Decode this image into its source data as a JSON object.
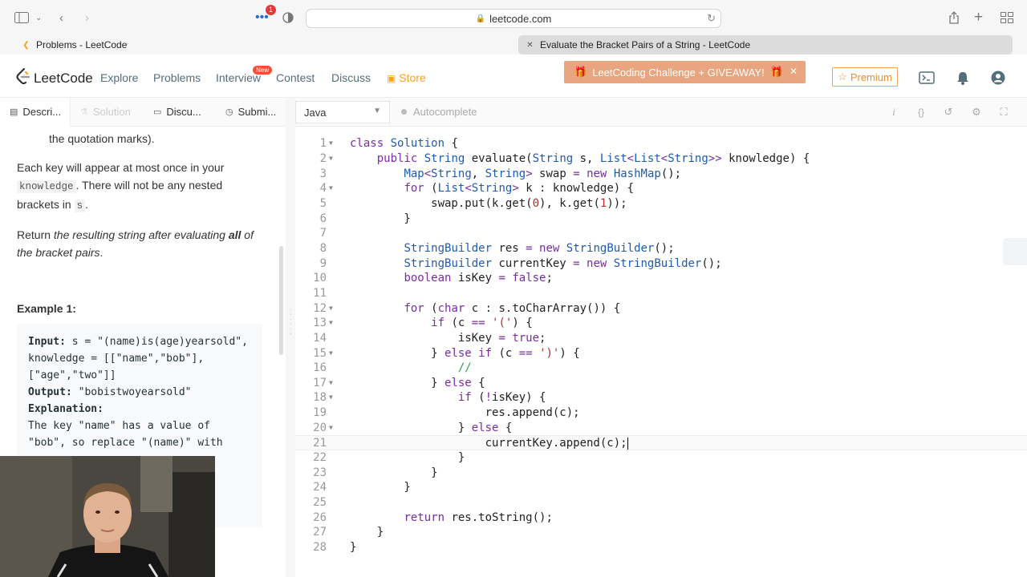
{
  "browser": {
    "url": "leetcode.com",
    "badge_count": "1"
  },
  "tabs": [
    {
      "title": "Problems - LeetCode"
    },
    {
      "title": "Evaluate the Bracket Pairs of a String - LeetCode"
    }
  ],
  "nav": {
    "brand": "LeetCode",
    "links": [
      "Explore",
      "Problems",
      "Interview",
      "Contest",
      "Discuss",
      "Store"
    ],
    "new_badge": "New",
    "promo": "LeetCoding Challenge + GIVEAWAY!",
    "premium": "Premium"
  },
  "left_tabs": [
    "Descri...",
    "Solution",
    "Discu...",
    "Submi..."
  ],
  "description": {
    "frag1": "the quotation marks).",
    "p1_a": "Each key will appear at most once in your ",
    "p1_code": "knowledge",
    "p1_b": ". There will not be any nested brackets in ",
    "p1_code2": "s",
    "p1_c": ".",
    "p2_a": "Return ",
    "p2_em": "the resulting string after evaluating ",
    "p2_strong": "all",
    "p2_em2": " of the bracket pairs",
    "p2_c": ".",
    "example_title": "Example 1:"
  },
  "example": {
    "input_label": "Input:",
    "input_value": " s = \"(name)is(age)yearsold\", knowledge = [[\"name\",\"bob\"],[\"age\",\"two\"]]",
    "output_label": "Output:",
    "output_value": " \"bobistwoyearsold\"",
    "explanation_label": "Explanation:",
    "explanation_text": "The key \"name\" has a value of \"bob\", so replace \"(name)\" with"
  },
  "editor": {
    "language": "Java",
    "autocomplete": "Autocomplete",
    "active_line": 21,
    "code_lines": [
      "class Solution {",
      "    public String evaluate(String s, List<List<String>> knowledge) {",
      "        Map<String, String> swap = new HashMap();",
      "        for (List<String> k : knowledge) {",
      "            swap.put(k.get(0), k.get(1));",
      "        }",
      "",
      "        StringBuilder res = new StringBuilder();",
      "        StringBuilder currentKey = new StringBuilder();",
      "        boolean isKey = false;",
      "",
      "        for (char c : s.toCharArray()) {",
      "            if (c == '(') {",
      "                isKey = true;",
      "            } else if (c == ')') {",
      "                //",
      "            } else {",
      "                if (!isKey) {",
      "                    res.append(c);",
      "                } else {",
      "                    currentKey.append(c);",
      "                }",
      "            }",
      "        }",
      "",
      "        return res.toString();",
      "    }",
      "}"
    ],
    "fold_lines": [
      1,
      2,
      4,
      12,
      13,
      15,
      17,
      18,
      20
    ]
  },
  "colors": {
    "keyword": "#7a2ba6",
    "type": "#1e5bb0",
    "string": "#b0302f",
    "comment": "#2e9a5a",
    "store": "#ffa116"
  }
}
